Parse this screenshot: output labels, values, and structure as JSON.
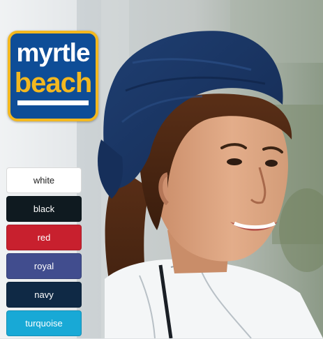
{
  "logo": {
    "line1": "myrtle",
    "line2": "beach"
  },
  "colors": [
    {
      "label": "white",
      "bg": "#ffffff",
      "fg": "#222222"
    },
    {
      "label": "black",
      "bg": "#0f1a20",
      "fg": "#ffffff"
    },
    {
      "label": "red",
      "bg": "#c8202e",
      "fg": "#ffffff"
    },
    {
      "label": "royal",
      "bg": "#414d8e",
      "fg": "#ffffff"
    },
    {
      "label": "navy",
      "bg": "#0f2945",
      "fg": "#ffffff"
    },
    {
      "label": "turquoise",
      "bg": "#18a9d6",
      "fg": "#ffffff"
    }
  ]
}
